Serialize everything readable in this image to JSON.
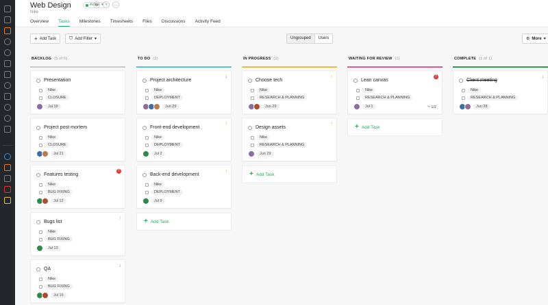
{
  "header": {
    "title": "Web Design",
    "subtitle": "Nike",
    "status_badge": "Active"
  },
  "tabs": [
    "Overview",
    "Tasks",
    "Milestones",
    "Timesheets",
    "Files",
    "Discussions",
    "Activity Feed"
  ],
  "active_tab": "Tasks",
  "toolbar": {
    "add_task": "Add Task",
    "add_filter": "Add Filter",
    "ungrouped": "Ungrouped",
    "users": "Users",
    "more": "More"
  },
  "columns": [
    {
      "name": "BACKLOG",
      "count": "(5 of 5)",
      "color": "#c8c8c8",
      "cards": [
        {
          "title": "Presentation",
          "client": "Nike",
          "tag": "CLOSURE",
          "date": "Jul 19",
          "avatars": [
            "#8a6f9e"
          ],
          "priority": "",
          "done": false
        },
        {
          "title": "Project post-mortem",
          "client": "Nike",
          "tag": "CLOSURE",
          "date": "Jul 21",
          "avatars": [
            "#3d6ea8",
            "#c0794f"
          ],
          "priority": "",
          "done": false
        },
        {
          "title": "Features testing",
          "client": "Nike",
          "tag": "BUG FIXING",
          "date": "Jul 12",
          "avatars": [
            "#2f8a4a",
            "#b04a30"
          ],
          "priority": "alert",
          "done": false
        },
        {
          "title": "Bugs list",
          "client": "Nike",
          "tag": "BUG FIXING",
          "date": "Jul 13",
          "avatars": [
            "#2f8a4a"
          ],
          "priority": "up",
          "done": false
        },
        {
          "title": "QA",
          "client": "Nike",
          "tag": "BUG FIXING",
          "date": "Jul 16",
          "avatars": [
            "#2f8a4a",
            "#b04a30"
          ],
          "priority": "down",
          "done": false
        }
      ]
    },
    {
      "name": "TO DO",
      "count": "(3)",
      "color": "#5bc3d6",
      "cards": [
        {
          "title": "Project architecture",
          "client": "Nike",
          "tag": "DEPLOYMENT",
          "date": "Jun 29",
          "avatars": [
            "#8a6f9e",
            "#3d6ea8",
            "#c0794f"
          ],
          "priority": "down",
          "done": false
        },
        {
          "title": "Front-end development",
          "client": "Nike",
          "tag": "DEPLOYMENT",
          "date": "Jul 2",
          "avatars": [
            "#2f8a4a"
          ],
          "priority": "up",
          "done": false
        },
        {
          "title": "Back-end development",
          "client": "Nike",
          "tag": "DEPLOYMENT",
          "date": "Jul 9",
          "avatars": [
            "#2f8a4a"
          ],
          "priority": "up",
          "done": false
        }
      ],
      "add_task": "Add Task"
    },
    {
      "name": "IN PROGRESS",
      "count": "(2)",
      "color": "#f0b93a",
      "cards": [
        {
          "title": "Choose tech",
          "client": "Nike",
          "tag": "RESEARCH & PLANNING",
          "date": "Jun 29",
          "avatars": [
            "#8a6f9e",
            "#b04a30"
          ],
          "priority": "up",
          "done": false
        },
        {
          "title": "Design assets",
          "client": "Nike",
          "tag": "RESEARCH & PLANNING",
          "date": "Jun 29",
          "avatars": [
            "#8a6f9e"
          ],
          "priority": "up",
          "done": false
        }
      ],
      "add_task": "Add Task"
    },
    {
      "name": "WAITING FOR REVIEW",
      "count": "(1)",
      "color": "#e0569a",
      "cards": [
        {
          "title": "Lean canvas",
          "client": "Nike",
          "tag": "RESEARCH & PLANNING",
          "date": "Jul 1",
          "avatars": [
            "#8a6f9e"
          ],
          "priority": "alert",
          "done": false,
          "subtasks": "1/2"
        }
      ],
      "add_task": "Add Task"
    },
    {
      "name": "COMPLETE",
      "count": "(1 of 1)",
      "color": "#2e9a4e",
      "cards": [
        {
          "title": "Client meeting",
          "client": "Nike",
          "tag": "RESEARCH & PLANNING",
          "date": "Jun 28",
          "avatars": [
            "#3d6ea8",
            "#8a6f9e"
          ],
          "priority": "down",
          "done": true
        }
      ]
    }
  ]
}
